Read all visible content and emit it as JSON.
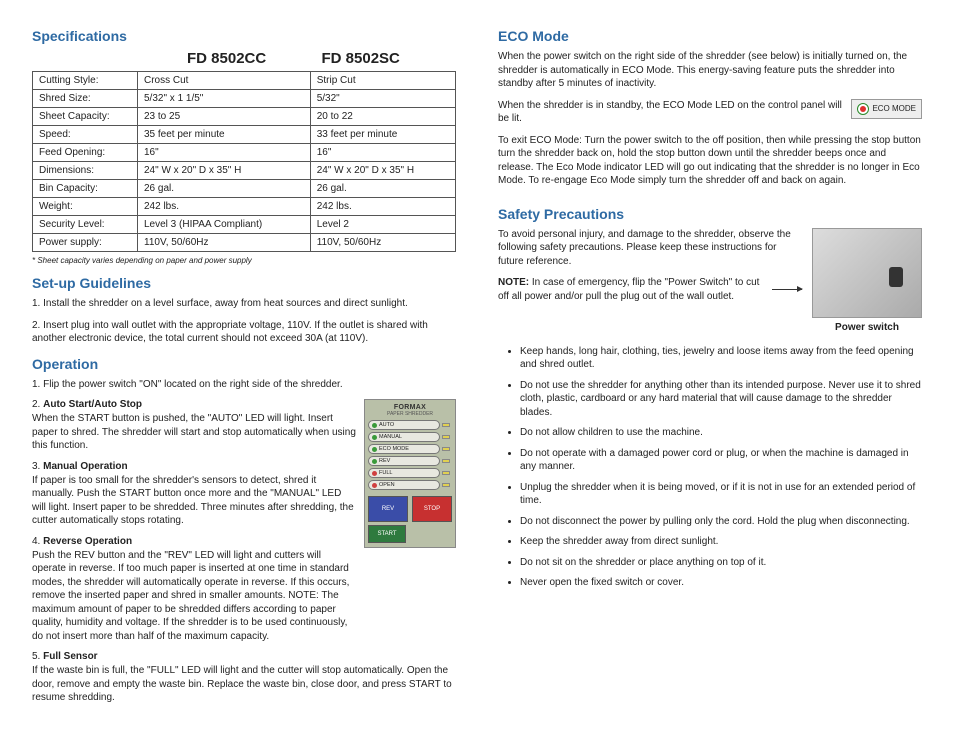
{
  "left": {
    "specs_heading": "Specifications",
    "models": {
      "a": "FD 8502CC",
      "b": "FD 8502SC"
    },
    "rows": [
      {
        "label": "Cutting Style:",
        "a": "Cross Cut",
        "b": "Strip Cut"
      },
      {
        "label": "Shred Size:",
        "a": "5/32\" x 1 1/5\"",
        "b": "5/32\""
      },
      {
        "label": "Sheet Capacity:",
        "a": "23 to 25",
        "b": "20 to 22"
      },
      {
        "label": "Speed:",
        "a": "35 feet per minute",
        "b": "33 feet per minute"
      },
      {
        "label": "Feed Opening:",
        "a": "16\"",
        "b": "16\""
      },
      {
        "label": "Dimensions:",
        "a": "24\" W x 20\" D x 35\" H",
        "b": "24\" W x 20\" D x 35\" H"
      },
      {
        "label": "Bin Capacity:",
        "a": "26 gal.",
        "b": "26 gal."
      },
      {
        "label": "Weight:",
        "a": "242 lbs.",
        "b": "242 lbs."
      },
      {
        "label": "Security Level:",
        "a": "Level 3 (HIPAA Compliant)",
        "b": "Level 2"
      },
      {
        "label": "Power supply:",
        "a": "110V, 50/60Hz",
        "b": "110V, 50/60Hz"
      }
    ],
    "footnote": "* Sheet capacity varies depending on paper and power supply",
    "setup_heading": "Set-up Guidelines",
    "setup1": "1. Install the shredder on a level surface, away from heat sources and direct sunlight.",
    "setup2": "2. Insert plug into wall outlet with the appropriate voltage, 110V. If the outlet is shared with another electronic device, the total current should not exceed 30A (at 110V).",
    "op_heading": "Operation",
    "op1": "1. Flip the power switch \"ON\" located on the right side of the shredder.",
    "op2h": "Auto Start/Auto Stop",
    "op2": "When the START button is pushed, the \"AUTO\" LED will light. Insert paper to shred. The shredder will start and stop automatically when using this function.",
    "op3h": "Manual Operation",
    "op3": "If paper is too small for the shredder's sensors to detect, shred it manually. Push the START button once more and the \"MANUAL\" LED will light. Insert paper to be shredded. Three minutes after shredding, the cutter automatically stops rotating.",
    "op4h": "Reverse Operation",
    "op4": "Push the REV button and the \"REV\" LED will light and cutters will operate in reverse. If too much paper is inserted at one time in standard modes, the shredder will automatically operate in reverse. If this occurs, remove the inserted paper and shred in smaller amounts. NOTE: The maximum amount of paper to be shredded differs according to paper quality, humidity and voltage. If the shredder is to be used continuously, do not insert more than half of the maximum capacity.",
    "op5h": "Full Sensor",
    "op5": "If the waste bin is full, the \"FULL\" LED will light and the cutter will stop automatically. Open the door, remove and empty the waste bin. Replace the waste bin, close door, and press START to resume shredding.",
    "panel": {
      "brand": "FORMAX",
      "sub": "PAPER SHREDDER",
      "btns": [
        "AUTO",
        "MANUAL",
        "ECO MODE",
        "REV",
        "FULL",
        "OPEN"
      ],
      "rev": "REV",
      "stop": "STOP",
      "start": "START"
    }
  },
  "right": {
    "eco_heading": "ECO Mode",
    "eco1": "When the power switch on the right side of the shredder (see below) is initially turned on, the shredder is automatically in ECO Mode. This energy-saving feature puts the shredder into standby after 5 minutes of inactivity.",
    "eco2": "When the shredder is in standby, the ECO Mode LED on the control panel will be lit.",
    "eco_badge": "ECO MODE",
    "eco3": "To exit ECO Mode: Turn the power switch to the off position, then while pressing the stop button turn the shredder back on, hold the stop button down until the shredder beeps once and release.  The Eco Mode indicator LED will go out indicating that the shredder is no longer in Eco Mode.  To re-engage Eco Mode simply turn the shredder off and back on again.",
    "safety_heading": "Safety Precautions",
    "safety_intro": "To avoid personal injury, and damage to the shredder, observe the following safety precautions. Please keep these instructions for future reference.",
    "note_label": "NOTE:",
    "note_body": " In case of emergency, flip the \"Power Switch\" to cut off all power and/or pull the plug out of the wall outlet.",
    "pswitch_caption": "Power switch",
    "bullets": [
      "Keep hands, long hair, clothing, ties, jewelry and loose items away from the feed opening and shred outlet.",
      "Do not use the shredder for anything other than its intended purpose. Never use it to shred cloth, plastic, cardboard or any hard material that will cause damage to the shredder blades.",
      "Do not allow children to use the machine.",
      "Do not operate with a damaged power cord or plug, or when the machine is damaged in any manner.",
      "Unplug the shredder when it is being moved, or if it is not in use for an extended period of time.",
      "Do not disconnect the power by pulling only the cord. Hold the plug when disconnecting.",
      "Keep the shredder away from direct sunlight.",
      "Do not sit on the shredder or place anything on top of it.",
      "Never open the fixed switch or cover."
    ]
  }
}
